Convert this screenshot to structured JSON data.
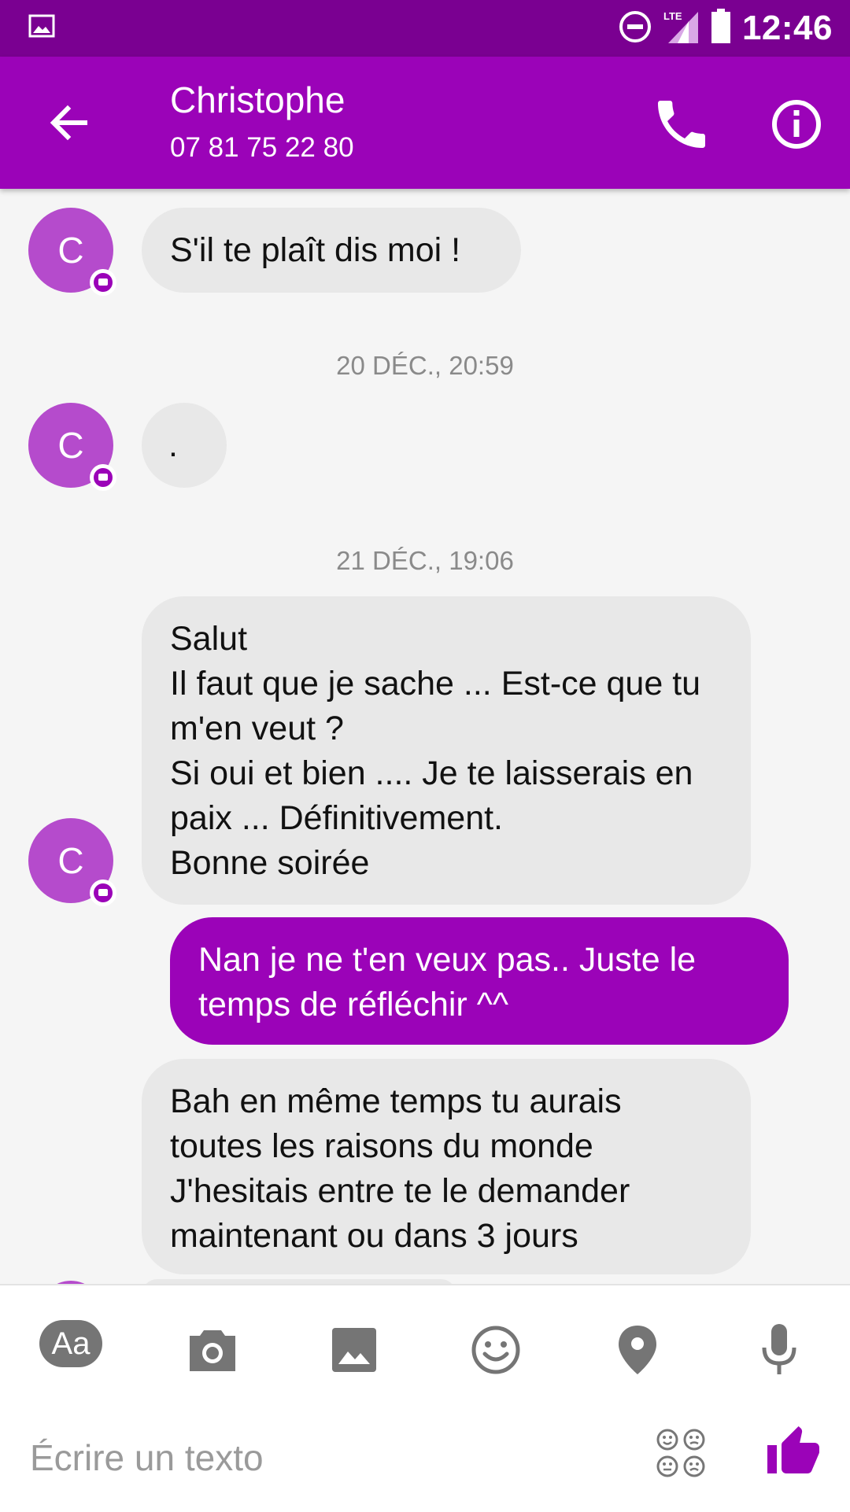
{
  "status_bar": {
    "time": "12:46",
    "network": "LTE"
  },
  "header": {
    "contact_name": "Christophe",
    "phone_number": "07 81 75 22 80"
  },
  "avatar_initial": "C",
  "messages": [
    {
      "direction": "in",
      "text": "S'il te plaît dis moi !"
    },
    {
      "type": "timestamp",
      "text": "20 DÉC., 20:59"
    },
    {
      "direction": "in",
      "text": "."
    },
    {
      "type": "timestamp",
      "text": "21 DÉC., 19:06"
    },
    {
      "direction": "in",
      "text": "Salut\nIl faut que je sache ... Est-ce que tu m'en veut ?\nSi oui et bien .... Je te laisserais en paix ... Définitivement.\nBonne soirée"
    },
    {
      "direction": "out",
      "text": "Nan je ne t'en veux pas.. Juste le temps de réfléchir ^^"
    },
    {
      "direction": "in",
      "text": "Bah en même temps tu aurais toutes les raisons du monde\nJ'hesitais entre te le demander maintenant ou dans 3 jours"
    }
  ],
  "composer": {
    "format_label": "Aa",
    "placeholder": "Écrire un texto",
    "tools": [
      "camera-icon",
      "gallery-icon",
      "emoji-icon",
      "location-icon",
      "microphone-icon"
    ]
  },
  "colors": {
    "status_bar": "#7a0091",
    "accent": "#9b03b8",
    "avatar": "#b54bcc",
    "incoming_bubble": "#e8e8e8"
  }
}
